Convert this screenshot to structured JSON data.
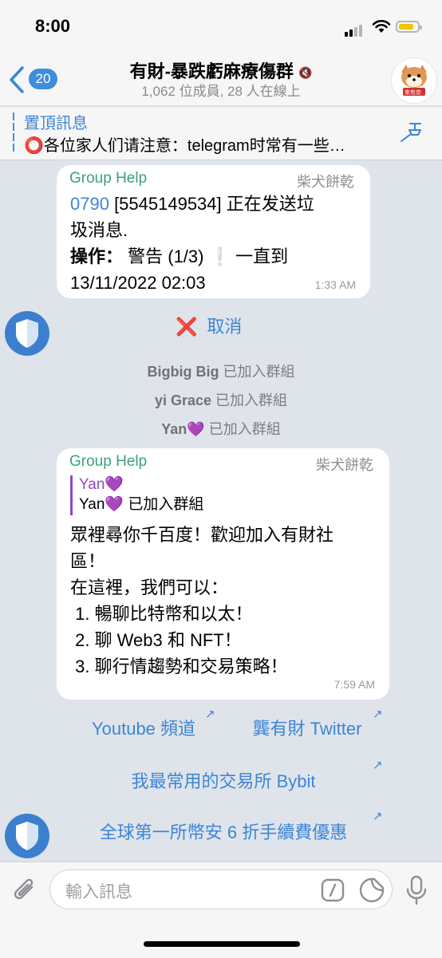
{
  "status_bar": {
    "time": "8:00"
  },
  "header": {
    "back_count": "20",
    "title": "有財-暴跌虧麻療傷群",
    "subtitle": "1,062 位成員, 28 人在線上",
    "avatar_text": "來有奈"
  },
  "pinned": {
    "label": "置頂訊息",
    "text": "⭕各位家人们请注意：telegram时常有一些…"
  },
  "message1": {
    "sender": "Group Help",
    "rank": "柴犬餅乾",
    "line1_link": "0790",
    "line1_rest": " [5545149534] 正在发送垃",
    "line2": "圾消息.",
    "line3_bold": "操作：",
    "line3_rest": " 警告 (1/3) ❕ 一直到",
    "line4": "13/11/2022 02:03",
    "time": "1:33 AM"
  },
  "cancel_button": {
    "icon": "❌",
    "label": "取消"
  },
  "service": [
    {
      "name": "Bigbig Big",
      "action": " 已加入群組"
    },
    {
      "name": "yi Grace",
      "action": " 已加入群組"
    },
    {
      "name": "Yan💜",
      "action": " 已加入群組"
    }
  ],
  "message2": {
    "sender": "Group Help",
    "rank": "柴犬餅乾",
    "reply_name": "Yan💜",
    "reply_text": "Yan💜 已加入群組",
    "lines": [
      "眾裡尋你千百度！歡迎加入有財社",
      "區！",
      "在這裡，我們可以：",
      " 1. 暢聊比特幣和以太！",
      " 2. 聊 Web3 和 NFT！",
      " 3. 聊行情趨勢和交易策略！"
    ],
    "time": "7:59 AM"
  },
  "inline_buttons": [
    {
      "label": "Youtube 頻道"
    },
    {
      "label": "龔有財 Twitter"
    },
    {
      "label": "我最常用的交易所 Bybit"
    },
    {
      "label": "全球第一所幣安 6 折手續費優惠"
    }
  ],
  "input": {
    "placeholder": "輸入訊息"
  },
  "icons": {
    "back": "chevron-left-icon",
    "mute": "mute-icon",
    "pin": "pin-icon",
    "attach": "paperclip-icon",
    "command": "slash-command-icon",
    "sticker": "sticker-icon",
    "mic": "microphone-icon",
    "shield": "shield-icon"
  },
  "colors": {
    "accent": "#3d85d6",
    "sender": "#3aa27a",
    "chat_bg": "#dfe4ea"
  }
}
